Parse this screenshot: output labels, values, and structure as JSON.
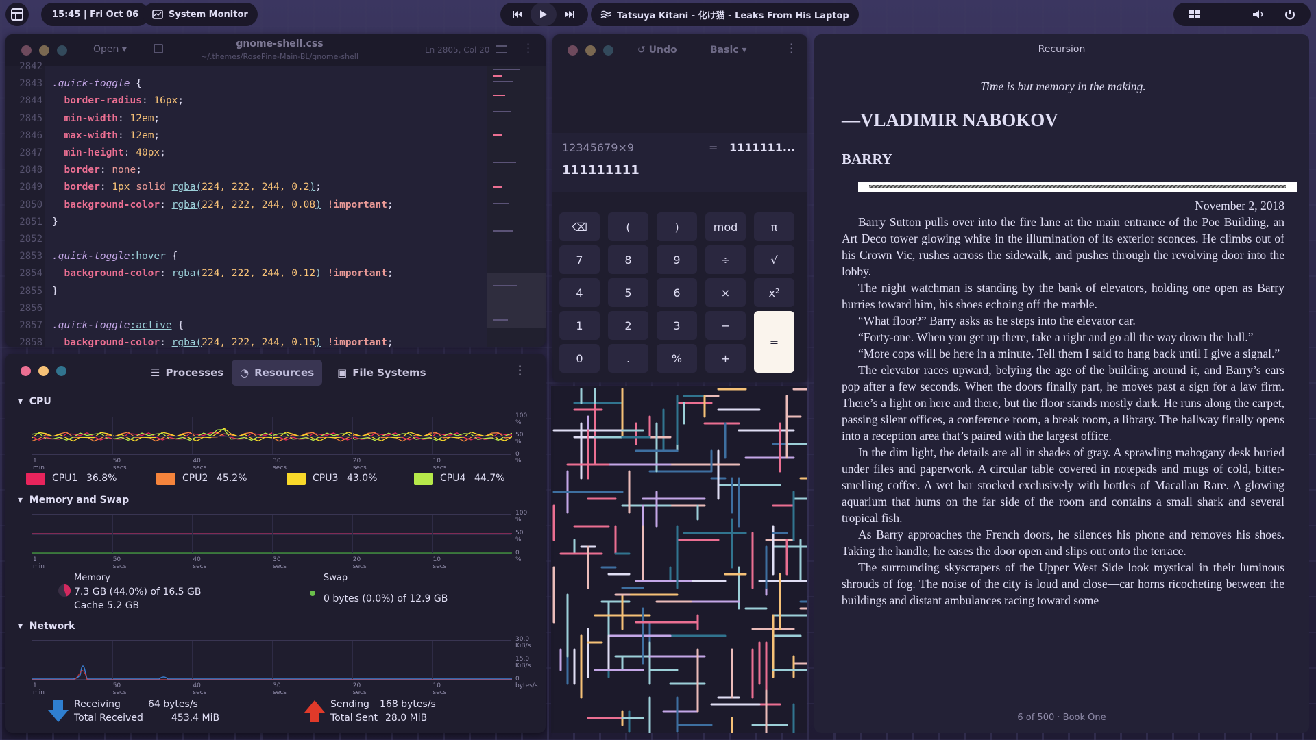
{
  "topbar": {
    "clock": "15:45 | Fri Oct 06",
    "app": "System Monitor",
    "track": "Tatsuya Kitani - 化け猫 - Leaks From His Laptop"
  },
  "editor": {
    "open_label": "Open",
    "filename": "gnome-shell.css",
    "path": "~/.themes/RosePine-Main-BL/gnome-shell",
    "position": "Ln 2805, Col 20",
    "lines": [
      {
        "n": "2842",
        "parts": []
      },
      {
        "n": "2843",
        "parts": [
          {
            "t": ".quick-toggle",
            "c": "sel"
          },
          {
            "t": " {",
            "c": ""
          }
        ]
      },
      {
        "n": "2844",
        "parts": [
          {
            "t": "  border-radius",
            "c": "prop"
          },
          {
            "t": ": ",
            "c": ""
          },
          {
            "t": "16px",
            "c": "num"
          },
          {
            "t": ";",
            "c": ""
          }
        ]
      },
      {
        "n": "2845",
        "parts": [
          {
            "t": "  min-width",
            "c": "prop"
          },
          {
            "t": ": ",
            "c": ""
          },
          {
            "t": "12em",
            "c": "num"
          },
          {
            "t": ";",
            "c": ""
          }
        ]
      },
      {
        "n": "2846",
        "parts": [
          {
            "t": "  max-width",
            "c": "prop"
          },
          {
            "t": ": ",
            "c": ""
          },
          {
            "t": "12em",
            "c": "num"
          },
          {
            "t": ";",
            "c": ""
          }
        ]
      },
      {
        "n": "2847",
        "parts": [
          {
            "t": "  min-height",
            "c": "prop"
          },
          {
            "t": ": ",
            "c": ""
          },
          {
            "t": "40px",
            "c": "num"
          },
          {
            "t": ";",
            "c": ""
          }
        ]
      },
      {
        "n": "2848",
        "parts": [
          {
            "t": "  border",
            "c": "prop"
          },
          {
            "t": ": ",
            "c": ""
          },
          {
            "t": "none",
            "c": "val"
          },
          {
            "t": ";",
            "c": ""
          }
        ]
      },
      {
        "n": "2849",
        "parts": [
          {
            "t": "  border",
            "c": "prop"
          },
          {
            "t": ": ",
            "c": ""
          },
          {
            "t": "1px",
            "c": "num"
          },
          {
            "t": " ",
            "c": ""
          },
          {
            "t": "solid",
            "c": "val"
          },
          {
            "t": " ",
            "c": ""
          },
          {
            "t": "rgba(",
            "c": "fn"
          },
          {
            "t": "224, 222, 244, 0.2",
            "c": "num"
          },
          {
            "t": ")",
            "c": "fn"
          },
          {
            "t": ";",
            "c": ""
          }
        ]
      },
      {
        "n": "2850",
        "parts": [
          {
            "t": "  background-color",
            "c": "prop"
          },
          {
            "t": ": ",
            "c": ""
          },
          {
            "t": "rgba(",
            "c": "fn"
          },
          {
            "t": "224, 222, 244, 0.08",
            "c": "num"
          },
          {
            "t": ")",
            "c": "fn"
          },
          {
            "t": " ",
            "c": ""
          },
          {
            "t": "!important",
            "c": "imp"
          },
          {
            "t": ";",
            "c": ""
          }
        ]
      },
      {
        "n": "2851",
        "parts": [
          {
            "t": "}",
            "c": ""
          }
        ]
      },
      {
        "n": "2852",
        "parts": []
      },
      {
        "n": "2853",
        "parts": [
          {
            "t": ".quick-toggle",
            "c": "sel"
          },
          {
            "t": ":hover",
            "c": "fn"
          },
          {
            "t": " {",
            "c": ""
          }
        ]
      },
      {
        "n": "2854",
        "parts": [
          {
            "t": "  background-color",
            "c": "prop"
          },
          {
            "t": ": ",
            "c": ""
          },
          {
            "t": "rgba(",
            "c": "fn"
          },
          {
            "t": "224, 222, 244, 0.12",
            "c": "num"
          },
          {
            "t": ")",
            "c": "fn"
          },
          {
            "t": " ",
            "c": ""
          },
          {
            "t": "!important",
            "c": "imp"
          },
          {
            "t": ";",
            "c": ""
          }
        ]
      },
      {
        "n": "2855",
        "parts": [
          {
            "t": "}",
            "c": ""
          }
        ]
      },
      {
        "n": "2856",
        "parts": []
      },
      {
        "n": "2857",
        "parts": [
          {
            "t": ".quick-toggle",
            "c": "sel"
          },
          {
            "t": ":active",
            "c": "fn"
          },
          {
            "t": " {",
            "c": ""
          }
        ]
      },
      {
        "n": "2858",
        "parts": [
          {
            "t": "  background-color",
            "c": "prop"
          },
          {
            "t": ": ",
            "c": ""
          },
          {
            "t": "rgba(",
            "c": "fn"
          },
          {
            "t": "224, 222, 244, 0.15",
            "c": "num"
          },
          {
            "t": ")",
            "c": "fn"
          },
          {
            "t": " ",
            "c": ""
          },
          {
            "t": "!important",
            "c": "imp"
          },
          {
            "t": ";",
            "c": ""
          }
        ]
      }
    ]
  },
  "calculator": {
    "undo": "Undo",
    "mode": "Basic",
    "expression": "12345679×9",
    "equals": "=",
    "result_short": "1111111...",
    "result": "111111111",
    "keys": [
      "⌫",
      "(",
      ")",
      "mod",
      "π",
      "7",
      "8",
      "9",
      "÷",
      "√",
      "4",
      "5",
      "6",
      "×",
      "x²",
      "1",
      "2",
      "3",
      "−",
      "=",
      "0",
      ".",
      "%",
      "+"
    ]
  },
  "monitor": {
    "tabs": [
      "Processes",
      "Resources",
      "File Systems"
    ],
    "cpu": {
      "title": "CPU",
      "cores": [
        {
          "name": "CPU1",
          "value": "36.8%",
          "color": "#e8245c"
        },
        {
          "name": "CPU2",
          "value": "45.2%",
          "color": "#f5843c"
        },
        {
          "name": "CPU3",
          "value": "43.0%",
          "color": "#f9d92a"
        },
        {
          "name": "CPU4",
          "value": "44.7%",
          "color": "#b6e94a"
        }
      ]
    },
    "memory": {
      "title": "Memory and Swap",
      "mem_label": "Memory",
      "mem_value": "7.3 GB (44.0%) of 16.5 GB",
      "cache": "Cache 5.2 GB",
      "swap_label": "Swap",
      "swap_value": "0 bytes (0.0%) of 12.9 GB"
    },
    "network": {
      "title": "Network",
      "recv_label": "Receiving",
      "recv_value": "64 bytes/s",
      "total_recv_label": "Total Received",
      "total_recv_value": "453.4 MiB",
      "send_label": "Sending",
      "send_value": "168 bytes/s",
      "total_sent_label": "Total Sent",
      "total_sent_value": "28.0 MiB"
    },
    "time_ticks": [
      "1 min",
      "50 secs",
      "40 secs",
      "30 secs",
      "20 secs",
      "10 secs"
    ],
    "pct_ticks": [
      "100 %",
      "50 %",
      "0 %"
    ],
    "net_ticks": [
      "30.0 KiB/s",
      "15.0 KiB/s",
      "0 bytes/s"
    ]
  },
  "reader": {
    "title": "Recursion",
    "epigraph": "Time is but memory in the making.",
    "attribution": "—VLADIMIR NABOKOV",
    "chapter": "BARRY",
    "date": "November 2, 2018",
    "paragraphs": [
      "Barry Sutton pulls over into the fire lane at the main entrance of the Poe Building, an Art Deco tower glowing white in the illumination of its exterior sconces. He climbs out of his Crown Vic, rushes across the sidewalk, and pushes through the revolving door into the lobby.",
      "The night watchman is standing by the bank of elevators, holding one open as Barry hurries toward him, his shoes echoing off the marble.",
      "“What floor?” Barry asks as he steps into the elevator car.",
      "“Forty-one. When you get up there, take a right and go all the way down the hall.”",
      "“More cops will be here in a minute. Tell them I said to hang back until I give a signal.”",
      "The elevator races upward, belying the age of the building around it, and Barry’s ears pop after a few seconds. When the doors finally part, he moves past a sign for a law firm. There’s a light on here and there, but the floor stands mostly dark. He runs along the carpet, passing silent offices, a confer­ence room, a break room, a library. The hallway finally opens into a reception area that’s paired with the largest office.",
      "In the dim light, the details are all in shades of gray. A sprawling mahogany desk buried under files and paperwork. A circular table covered in notepads and mugs of cold, bitter-smelling coffee. A wet bar stocked exclusively with bot­tles of Macallan Rare. A glowing aquarium that hums on the far side of the room and contains a small shark and several tropical fish.",
      "As Barry approaches the French doors, he silences his phone and removes his shoes. Taking the handle, he eases the door open and slips out onto the ter­race.",
      "The surrounding skyscrapers of the Upper West Side look mystical in their luminous shrouds of fog. The noise of the city is loud and close—car horns rico­cheting between the buildings and distant ambulances racing toward some"
    ],
    "page": "6 of 500",
    "book": "Book One"
  }
}
